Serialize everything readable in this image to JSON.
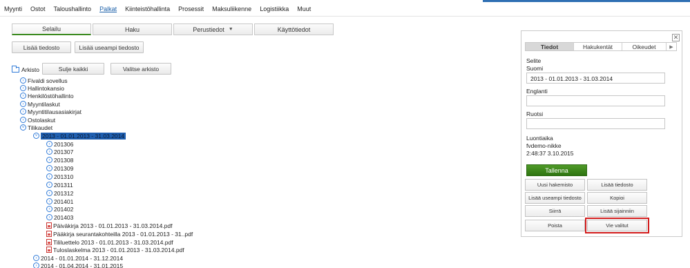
{
  "menu": {
    "items": [
      "Myynti",
      "Ostot",
      "Taloushallinto",
      "Palkat",
      "Kiinteistöhallinta",
      "Prosessit",
      "Maksuliikenne",
      "Logistiikka",
      "Muut"
    ]
  },
  "tabs": {
    "browse": "Selailu",
    "search": "Haku",
    "basic": "Perustiedot",
    "user": "Käyttötiedot"
  },
  "toolbar": {
    "add_file": "Lisää tiedosto",
    "add_multiple": "Lisää useampi tiedosto"
  },
  "tree": {
    "root": "Arkisto",
    "close_all": "Sulje kaikki",
    "choose_archive": "Valitse arkisto",
    "items": [
      "Fivaldi sovellus",
      "Hallintokansio",
      "Henkilöstöhallinto",
      "Myyntilaskut",
      "Myyntitilausasiakirjat",
      "Ostolaskut",
      "Tilikaudet"
    ],
    "selected_period": "2013 - 01.01.2013 - 31.03.2014",
    "months": [
      "201306",
      "201307",
      "201308",
      "201309",
      "201310",
      "201311",
      "201312",
      "201401",
      "201402",
      "201403"
    ],
    "files": [
      "Päiväkirja 2013 - 01.01.2013 - 31.03.2014.pdf",
      "Pääkirja seurantakohteilla 2013 - 01.01.2013 - 31..pdf",
      "Tililuettelo 2013 - 01.01.2013 - 31.03.2014.pdf",
      "Tuloslaskelma 2013 - 01.01.2013 - 31.03.2014.pdf"
    ],
    "periods": [
      "2014 - 01.01.2014 - 31.12.2014",
      "2014 - 01.04.2014 - 31.01.2015"
    ]
  },
  "panel": {
    "close": "✕",
    "tabs": [
      "Tiedot",
      "Hakukentät",
      "Oikeudet"
    ],
    "tab_arrow": "▶",
    "selite_label": "Selite",
    "suomi_label": "Suomi",
    "suomi_value": "2013 - 01.01.2013 - 31.03.2014",
    "englanti_label": "Englanti",
    "englanti_value": "",
    "ruotsi_label": "Ruotsi",
    "ruotsi_value": "",
    "created_label": "Luontiaika",
    "created_by": "fvdemo-nikke",
    "created_at": "2:48:37 3.10.2015",
    "save": "Tallenna",
    "actions": [
      "Uusi hakemisto",
      "Lisää tiedosto",
      "Lisää useampi tiedosto",
      "Kopioi",
      "Siirrä",
      "Lisää sijainniin",
      "Poista",
      "Vie valitut"
    ]
  },
  "colors": {
    "accent_green": "#3b8a1f",
    "link_blue": "#1a5fa8",
    "selection": "#1f5fb0",
    "highlight_red": "#d21a1a"
  },
  "icons": {
    "expand": "circle-chevron-icon",
    "collapse": "circle-minus-icon",
    "file": "pdf-icon",
    "folder": "folder-icon"
  }
}
